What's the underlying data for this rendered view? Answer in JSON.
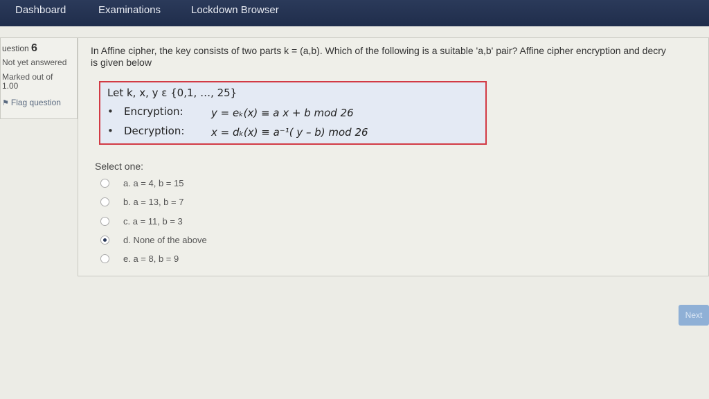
{
  "nav": {
    "items": [
      "Dashboard",
      "Examinations",
      "Lockdown Browser"
    ]
  },
  "info": {
    "question_prefix": "uestion",
    "question_number": "6",
    "status": "Not yet answered",
    "marked_label": "Marked out of",
    "marked_value": "1.00",
    "flag_label": "Flag question"
  },
  "question": {
    "line1": "In Affine cipher, the key consists of two parts k = (a,b). Which of the following is a suitable 'a,b' pair? Affine cipher encryption and decry",
    "line2": "is given below"
  },
  "formula": {
    "set_line": "Let k, x, y ε {0,1, …, 25}",
    "enc_label": "Encryption:",
    "enc_expr": "y = eₖ(x) ≡ a x + b mod 26",
    "dec_label": "Decryption:",
    "dec_expr": "x = dₖ(x) ≡ a⁻¹( y – b) mod 26"
  },
  "answer": {
    "prompt": "Select one:",
    "options": [
      {
        "label": "a. a = 4, b = 15",
        "selected": false
      },
      {
        "label": "b. a = 13, b = 7",
        "selected": false
      },
      {
        "label": "c. a = 11, b = 3",
        "selected": false
      },
      {
        "label": "d. None of the above",
        "selected": true
      },
      {
        "label": "e. a = 8, b = 9",
        "selected": false
      }
    ]
  },
  "next_label": "Next",
  "colors": {
    "navbar": "#1f2d4b",
    "formula_border": "#d23a44",
    "formula_bg": "#e4eaf4",
    "next_button": "#8fb0d6"
  }
}
